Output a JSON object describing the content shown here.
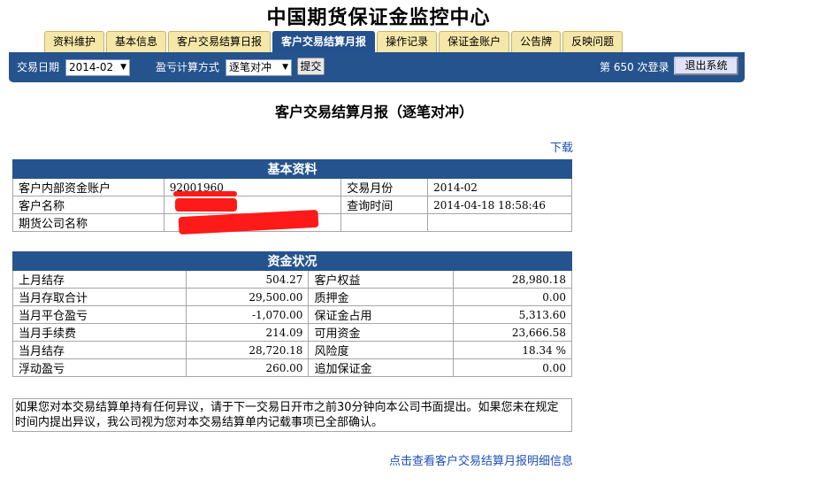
{
  "site_title": "中国期货保证金监控中心",
  "tabs": [
    {
      "label": "资料维护",
      "active": false
    },
    {
      "label": "基本信息",
      "active": false
    },
    {
      "label": "客户交易结算日报",
      "active": false
    },
    {
      "label": "客户交易结算月报",
      "active": true
    },
    {
      "label": "操作记录",
      "active": false
    },
    {
      "label": "保证金账户",
      "active": false
    },
    {
      "label": "公告牌",
      "active": false
    },
    {
      "label": "反映问题",
      "active": false
    }
  ],
  "toolbar": {
    "trade_date_label": "交易日期",
    "trade_date_value": "2014-02",
    "pnl_method_label": "盈亏计算方式",
    "pnl_method_value": "逐笔对冲",
    "submit_label": "提交",
    "login_count_text": "第 650 次登录",
    "logout_label": "退出系统"
  },
  "report_title": "客户交易结算月报（逐笔对冲）",
  "download_label": "下载",
  "basic_info": {
    "header": "基本资料",
    "rows": [
      {
        "label": "客户内部资金账户",
        "value": "92001960",
        "label2": "交易月份",
        "value2": "2014-02"
      },
      {
        "label": "客户名称",
        "value": "",
        "label2": "查询时间",
        "value2": "2014-04-18 18:58:46"
      },
      {
        "label": "期货公司名称",
        "value": "",
        "label2": "",
        "value2": ""
      }
    ]
  },
  "funds": {
    "header": "资金状况",
    "rows": [
      {
        "label": "上月结存",
        "value": "504.27",
        "label2": "客户权益",
        "value2": "28,980.18"
      },
      {
        "label": "当月存取合计",
        "value": "29,500.00",
        "label2": "质押金",
        "value2": "0.00"
      },
      {
        "label": "当月平仓盈亏",
        "value": "-1,070.00",
        "label2": "保证金占用",
        "value2": "5,313.60"
      },
      {
        "label": "当月手续费",
        "value": "214.09",
        "label2": "可用资金",
        "value2": "23,666.58"
      },
      {
        "label": "当月结存",
        "value": "28,720.18",
        "label2": "风险度",
        "value2": "18.34 %"
      },
      {
        "label": "浮动盈亏",
        "value": "260.00",
        "label2": "追加保证金",
        "value2": "0.00"
      }
    ]
  },
  "notice": "如果您对本交易结算单持有任何异议，请于下一交易日开市之前30分钟向本公司书面提出。如果您未在规定时间内提出异议，我公司视为您对本交易结算单内记载事项已全部确认。",
  "detail_link": "点击查看客户交易结算月报明细信息",
  "colors": {
    "nav_blue": "#25538e",
    "tab_yellow": "#f5e7a8",
    "link_blue": "#1d50b8",
    "redaction": "#ff1a1a"
  }
}
